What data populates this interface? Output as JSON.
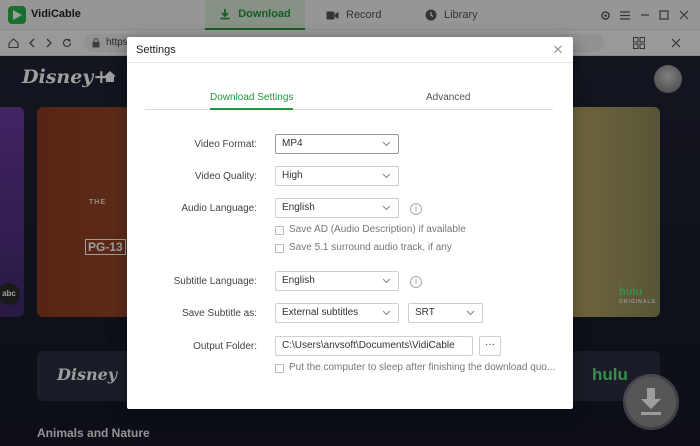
{
  "app": {
    "name": "VidiCable"
  },
  "tabs": [
    {
      "label": "Download",
      "active": true
    },
    {
      "label": "Record",
      "active": false
    },
    {
      "label": "Library",
      "active": false
    }
  ],
  "browser": {
    "url": "https"
  },
  "page": {
    "logo": "Disney+",
    "hero_the": "THE",
    "hero_rating": "PG-13",
    "hero_brand": "hulu",
    "hero_brand_sub": "ORIGINALS",
    "left_brand": "abc",
    "brand_disney": "Disney",
    "brand_hulu": "hulu",
    "section_title": "Animals and Nature"
  },
  "dialog": {
    "title": "Settings",
    "tabs": [
      {
        "label": "Download Settings",
        "active": true
      },
      {
        "label": "Advanced",
        "active": false
      }
    ],
    "video_format": {
      "label": "Video Format:",
      "value": "MP4"
    },
    "video_quality": {
      "label": "Video Quality:",
      "value": "High"
    },
    "audio_language": {
      "label": "Audio Language:",
      "value": "English"
    },
    "save_ad": {
      "label": "Save AD (Audio Description) if available",
      "checked": false
    },
    "save_51": {
      "label": "Save 5.1 surround audio track, if any",
      "checked": false
    },
    "subtitle_language": {
      "label": "Subtitle Language:",
      "value": "English"
    },
    "save_subtitle": {
      "label": "Save Subtitle as:",
      "value": "External subtitles",
      "format": "SRT"
    },
    "output_folder": {
      "label": "Output Folder:",
      "value": "C:\\Users\\anvsoft\\Documents\\VidiCable",
      "browse": "···"
    },
    "sleep": {
      "label": "Put the computer to sleep after finishing the download quo...",
      "checked": false
    }
  },
  "colors": {
    "accent": "#23963b",
    "app_icon": "#2bb24c"
  }
}
